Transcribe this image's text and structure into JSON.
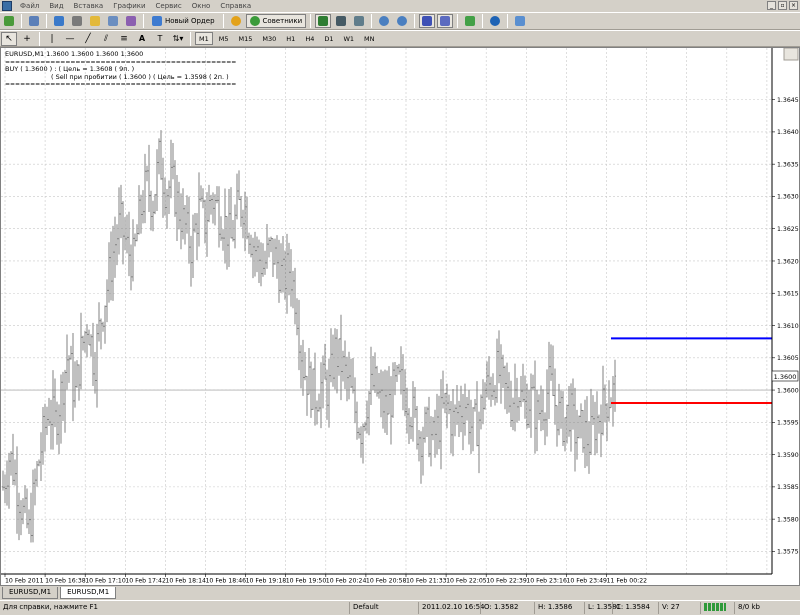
{
  "menu": {
    "items": [
      "Файл",
      "Вид",
      "Вставка",
      "Графики",
      "Сервис",
      "Окно",
      "Справка"
    ],
    "window_buttons": [
      "_",
      "▫",
      "×"
    ]
  },
  "toolbar": {
    "new_order_label": "Новый Ордер",
    "experts_label": "Советники",
    "timeframes": [
      "M1",
      "M5",
      "M15",
      "M30",
      "H1",
      "H4",
      "D1",
      "W1",
      "MN"
    ],
    "active_timeframe": "M1",
    "text_tool": "A"
  },
  "chart": {
    "header": "EURUSD,M1  1.3600 1.3600 1.3600 1.3600",
    "comment_sep": "==============================================",
    "comment_line1": "BUY  ( 1.3600 )  :  ( Цель  =  1.3608 ( 9п. )",
    "comment_line2": "( Sell  при пробитии ( 1.3600 )  ( Цель  =  1.3598 ( 2п. )",
    "current_price_label": "1.3600",
    "colors": {
      "bid_line": "#b0b0b0",
      "target_up": "#0000ff",
      "target_down": "#ff0000",
      "bars": "#808080",
      "grid": "#c8c8c8"
    }
  },
  "chart_data": {
    "type": "bar",
    "symbol": "EURUSD",
    "timeframe": "M1",
    "ylim": [
      1.35715,
      1.3653
    ],
    "y_ticks": [
      "1.3645",
      "1.3640",
      "1.3635",
      "1.3630",
      "1.3625",
      "1.3620",
      "1.3615",
      "1.3610",
      "1.3605",
      "1.3600",
      "1.3595",
      "1.3590",
      "1.3585",
      "1.3580",
      "1.3575"
    ],
    "x_ticks": [
      "10 Feb 2011",
      "10 Feb 16:38",
      "10 Feb 17:10",
      "10 Feb 17:42",
      "10 Feb 18:14",
      "10 Feb 18:46",
      "10 Feb 19:18",
      "10 Feb 19:50",
      "10 Feb 20:24",
      "10 Feb 20:58",
      "10 Feb 21:33",
      "10 Feb 22:05",
      "10 Feb 22:39",
      "10 Feb 23:16",
      "10 Feb 23:49",
      "11 Feb 00:22"
    ],
    "close_path": [
      1.3585,
      1.359,
      1.3586,
      1.3581,
      1.3578,
      1.3586,
      1.3592,
      1.3597,
      1.3595,
      1.36,
      1.3606,
      1.3599,
      1.3606,
      1.3611,
      1.3604,
      1.3611,
      1.3616,
      1.3622,
      1.3626,
      1.3622,
      1.362,
      1.3627,
      1.3632,
      1.3629,
      1.3636,
      1.3631,
      1.3632,
      1.3628,
      1.3625,
      1.3622,
      1.3628,
      1.3626,
      1.363,
      1.3628,
      1.3626,
      1.3623,
      1.3628,
      1.3629,
      1.3624,
      1.3621,
      1.3619,
      1.3622,
      1.362,
      1.3617,
      1.3619,
      1.3614,
      1.3604,
      1.3601,
      1.3599,
      1.3601,
      1.36,
      1.3606,
      1.3604,
      1.3601,
      1.3597,
      1.3594,
      1.3599,
      1.3601,
      1.3598,
      1.3597,
      1.36,
      1.3601,
      1.3599,
      1.3596,
      1.3593,
      1.3594,
      1.3592,
      1.3595,
      1.3598,
      1.3595,
      1.3597,
      1.3598,
      1.3594,
      1.3595,
      1.36,
      1.3601,
      1.3603,
      1.36,
      1.3598,
      1.3601,
      1.3597,
      1.3599,
      1.3596,
      1.3598,
      1.3601,
      1.3597,
      1.3595,
      1.3597,
      1.3593,
      1.3594,
      1.3592,
      1.3595,
      1.3597,
      1.3599,
      1.36
    ],
    "current_price": 1.36,
    "target_up": 1.3608,
    "target_down": 1.3598
  },
  "tabs": [
    "EURUSD,M1",
    "EURUSD,M1"
  ],
  "status": {
    "help": "Для справки, нажмите F1",
    "profile": "Default",
    "datetime": "2011.02.10 16:54",
    "open": "O: 1.3582",
    "high": "H: 1.3586",
    "low": "L: 1.3581",
    "close": "C: 1.3584",
    "volume": "V: 27",
    "traffic": "8/0 kb"
  }
}
